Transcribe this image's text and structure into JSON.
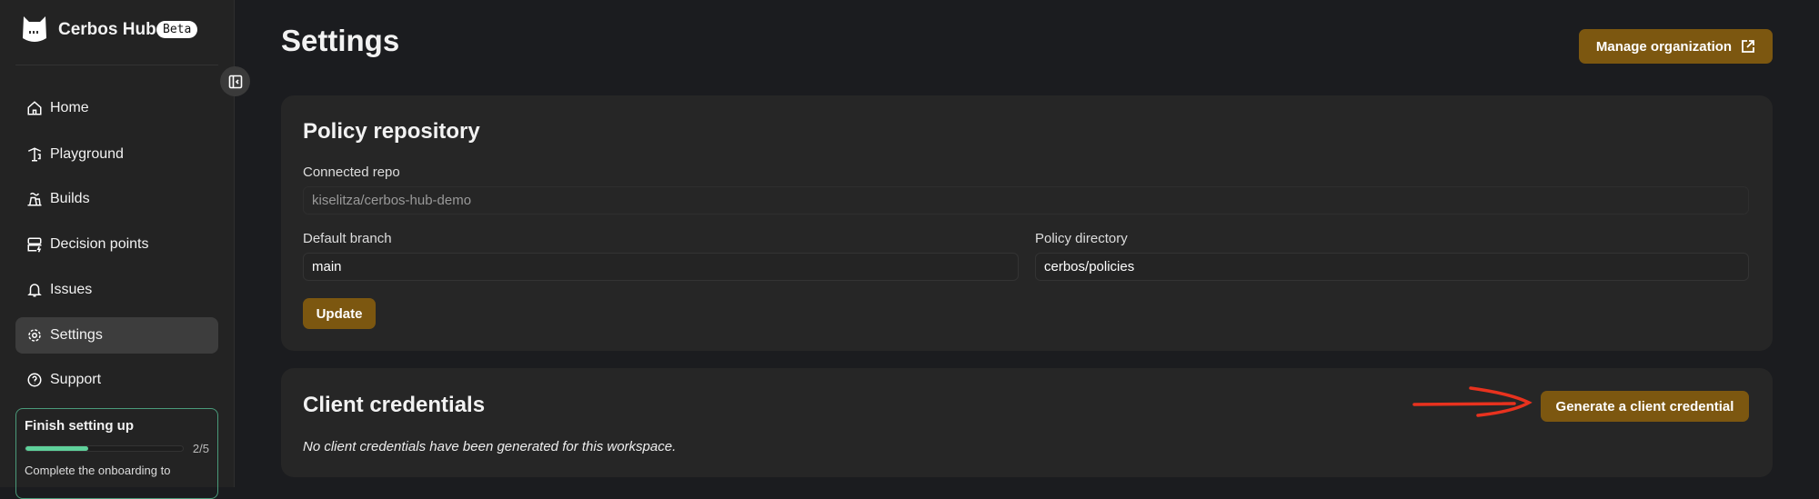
{
  "sidebar": {
    "brand": "Cerbos Hub",
    "badge": "Beta",
    "items": [
      {
        "label": "Home"
      },
      {
        "label": "Playground"
      },
      {
        "label": "Builds"
      },
      {
        "label": "Decision points"
      },
      {
        "label": "Issues"
      },
      {
        "label": "Settings"
      },
      {
        "label": "Support"
      }
    ],
    "onboarding": {
      "title": "Finish setting up",
      "progress": 0.4,
      "count": "2/5",
      "text": "Complete the onboarding to"
    }
  },
  "header": {
    "title": "Settings",
    "manage_label": "Manage organization"
  },
  "policy": {
    "title": "Policy repository",
    "repo_label": "Connected repo",
    "repo_value": "kiselitza/cerbos-hub-demo",
    "branch_label": "Default branch",
    "branch_value": "main",
    "dir_label": "Policy directory",
    "dir_value": "cerbos/policies",
    "update_label": "Update"
  },
  "credentials": {
    "title": "Client credentials",
    "generate_label": "Generate a client credential",
    "empty_text": "No client credentials have been generated for this workspace."
  },
  "colors": {
    "accent": "#7c5710",
    "progress": "#5fd19b",
    "annotation": "#e8321e"
  }
}
